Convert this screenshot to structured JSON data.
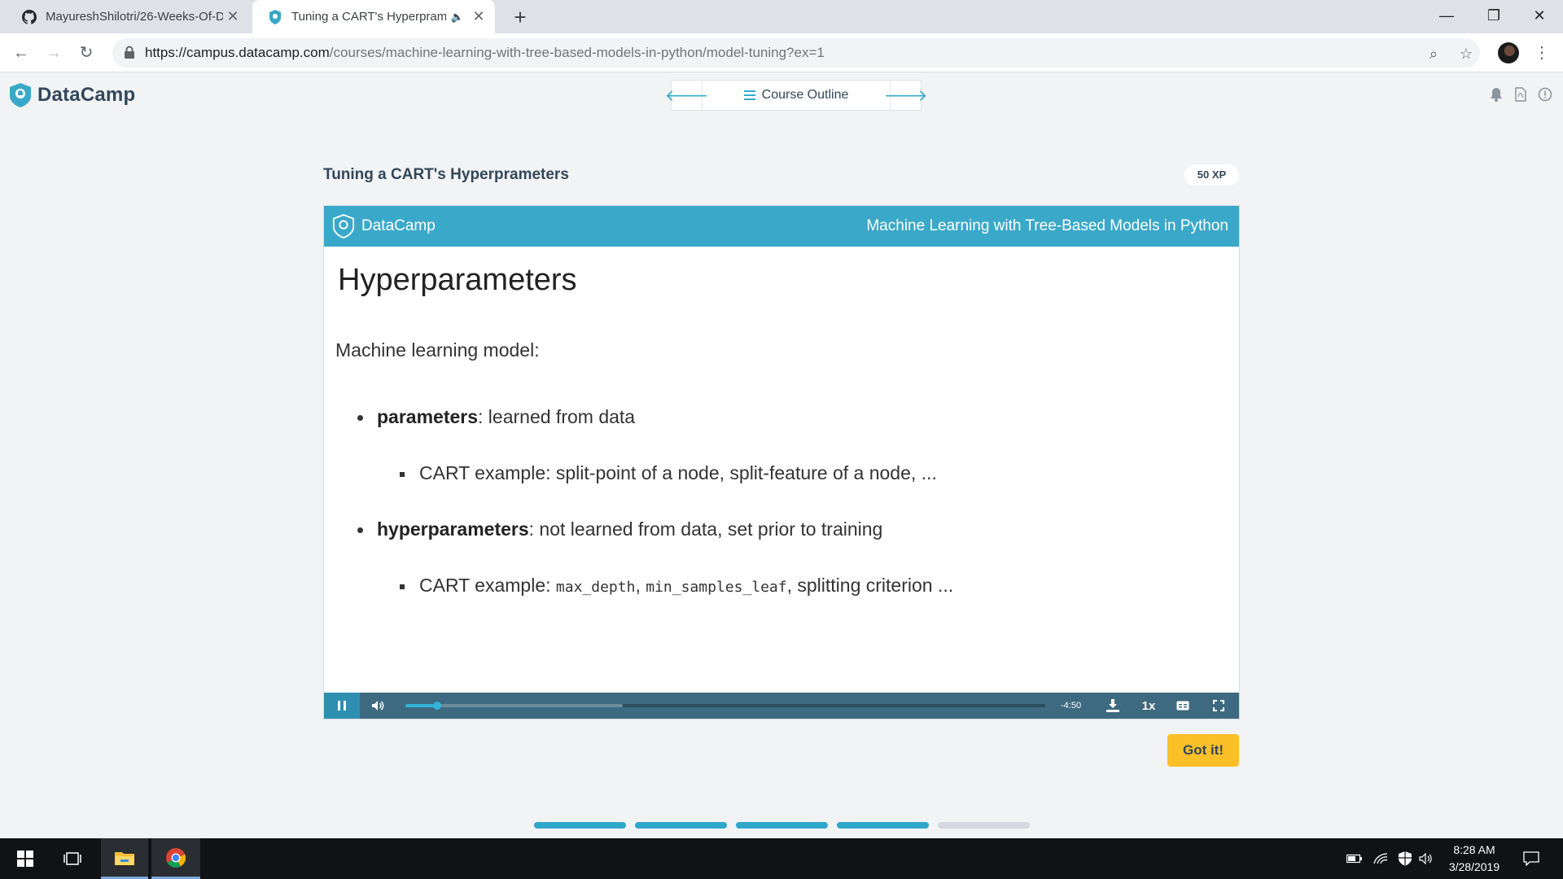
{
  "browser": {
    "tabs": [
      {
        "title": "MayureshShilotri/26-Weeks-Of-D",
        "active": false
      },
      {
        "title": "Tuning a CART's Hyperprame",
        "active": true
      }
    ],
    "url_host": "https://campus.datacamp.com",
    "url_path": "/courses/machine-learning-with-tree-based-models-in-python/model-tuning?ex=1"
  },
  "header": {
    "logo_text": "DataCamp",
    "course_outline_label": "Course Outline"
  },
  "exercise": {
    "title": "Tuning a CART's Hyperprameters",
    "xp_badge": "50 XP",
    "got_it_label": "Got it!"
  },
  "slide": {
    "brand": "DataCamp",
    "course": "Machine Learning with Tree-Based Models in Python",
    "heading": "Hyperparameters",
    "intro": "Machine learning model:",
    "b1_bold": "parameters",
    "b1_rest": ": learned from data",
    "b1_sub": "CART example: split-point of a node, split-feature of a node, ...",
    "b2_bold": "hyperparameters",
    "b2_rest": ": not learned from data, set prior to training",
    "b2_sub_pre": "CART example: ",
    "b2_sub_code1": "max_depth",
    "b2_sub_sep": ", ",
    "b2_sub_code2": "min_samples_leaf",
    "b2_sub_post": ", splitting criterion ..."
  },
  "player": {
    "time_remaining": "-4:50",
    "speed": "1x",
    "played_fraction": 0.05,
    "buffered_fraction": 0.34
  },
  "progress": {
    "segments_total": 5,
    "segments_done": 4,
    "done_color": "#2fa7c9",
    "todo_color": "#d3d9de"
  },
  "taskbar": {
    "time": "8:28 AM",
    "date": "3/28/2019"
  },
  "colors": {
    "accent": "#3aa8c9",
    "got_it": "#fbbf28",
    "navy": "#33475b"
  }
}
